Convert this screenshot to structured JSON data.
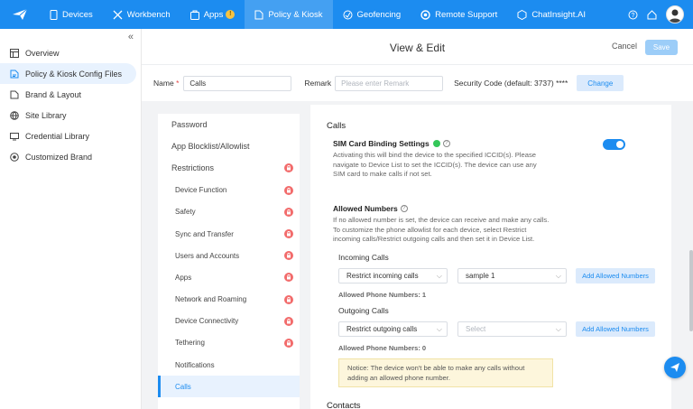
{
  "topbar": {
    "nav": [
      {
        "label": "Devices",
        "icon": "devices-icon"
      },
      {
        "label": "Workbench",
        "icon": "workbench-icon"
      },
      {
        "label": "Apps",
        "icon": "apps-icon",
        "badge": "!"
      },
      {
        "label": "Policy & Kiosk",
        "icon": "policy-icon",
        "active": true
      },
      {
        "label": "Geofencing",
        "icon": "geofence-icon"
      },
      {
        "label": "Remote Support",
        "icon": "remote-support-icon"
      },
      {
        "label": "ChatInsight.AI",
        "icon": "chatinsight-icon"
      }
    ],
    "accent": "#1c8cf0"
  },
  "sidebar": {
    "items": [
      {
        "label": "Overview",
        "icon": "overview-icon"
      },
      {
        "label": "Policy & Kiosk Config Files",
        "icon": "config-files-icon",
        "active": true
      },
      {
        "label": "Brand & Layout",
        "icon": "brand-layout-icon"
      },
      {
        "label": "Site Library",
        "icon": "globe-icon"
      },
      {
        "label": "Credential Library",
        "icon": "credential-icon"
      },
      {
        "label": "Customized Brand",
        "icon": "target-icon"
      }
    ]
  },
  "header": {
    "title": "View & Edit",
    "cancel": "Cancel",
    "save": "Save"
  },
  "form": {
    "name_label": "Name",
    "name_required": "*",
    "name_value": "Calls",
    "remark_label": "Remark",
    "remark_placeholder": "Please enter Remark",
    "security_code": "Security Code (default: 3737) ****",
    "change": "Change"
  },
  "menu": {
    "items": [
      {
        "label": "Password",
        "level": "top"
      },
      {
        "label": "App Blocklist/Allowlist",
        "level": "top"
      },
      {
        "label": "Restrictions",
        "level": "top",
        "locked": true
      },
      {
        "label": "Device Function",
        "level": "sub",
        "locked": true
      },
      {
        "label": "Safety",
        "level": "sub",
        "locked": true
      },
      {
        "label": "Sync and Transfer",
        "level": "sub",
        "locked": true
      },
      {
        "label": "Users and Accounts",
        "level": "sub",
        "locked": true
      },
      {
        "label": "Apps",
        "level": "sub",
        "locked": true
      },
      {
        "label": "Network and Roaming",
        "level": "sub",
        "locked": true
      },
      {
        "label": "Device Connectivity",
        "level": "sub",
        "locked": true
      },
      {
        "label": "Tethering",
        "level": "sub",
        "locked": true
      },
      {
        "label": "Notifications",
        "level": "sub"
      },
      {
        "label": "Calls",
        "level": "sub",
        "active": true
      }
    ]
  },
  "content": {
    "section_title": "Calls",
    "sim": {
      "title": "SIM Card Binding Settings",
      "desc": "Activating this will bind the device to the specified ICCID(s). Please navigate to Device List to set the ICCID(s). The device can use any SIM card to make calls if not set.",
      "enabled": true
    },
    "allowed": {
      "title": "Allowed Numbers",
      "desc": "If no allowed number is set, the device can receive and make any calls. To customize the phone allowlist for each device, select Restrict incoming calls/Restrict outgoing calls and then set it in Device List."
    },
    "incoming": {
      "label": "Incoming Calls",
      "mode": "Restrict incoming calls",
      "sample": "sample 1",
      "add": "Add Allowed Numbers",
      "count": "Allowed Phone Numbers: 1"
    },
    "outgoing": {
      "label": "Outgoing Calls",
      "mode": "Restrict outgoing calls",
      "placeholder": "Select",
      "add": "Add Allowed Numbers",
      "count": "Allowed Phone Numbers: 0"
    },
    "notice": "Notice: The device won't be able to make any calls without adding an allowed phone number.",
    "next_section": "Contacts"
  }
}
